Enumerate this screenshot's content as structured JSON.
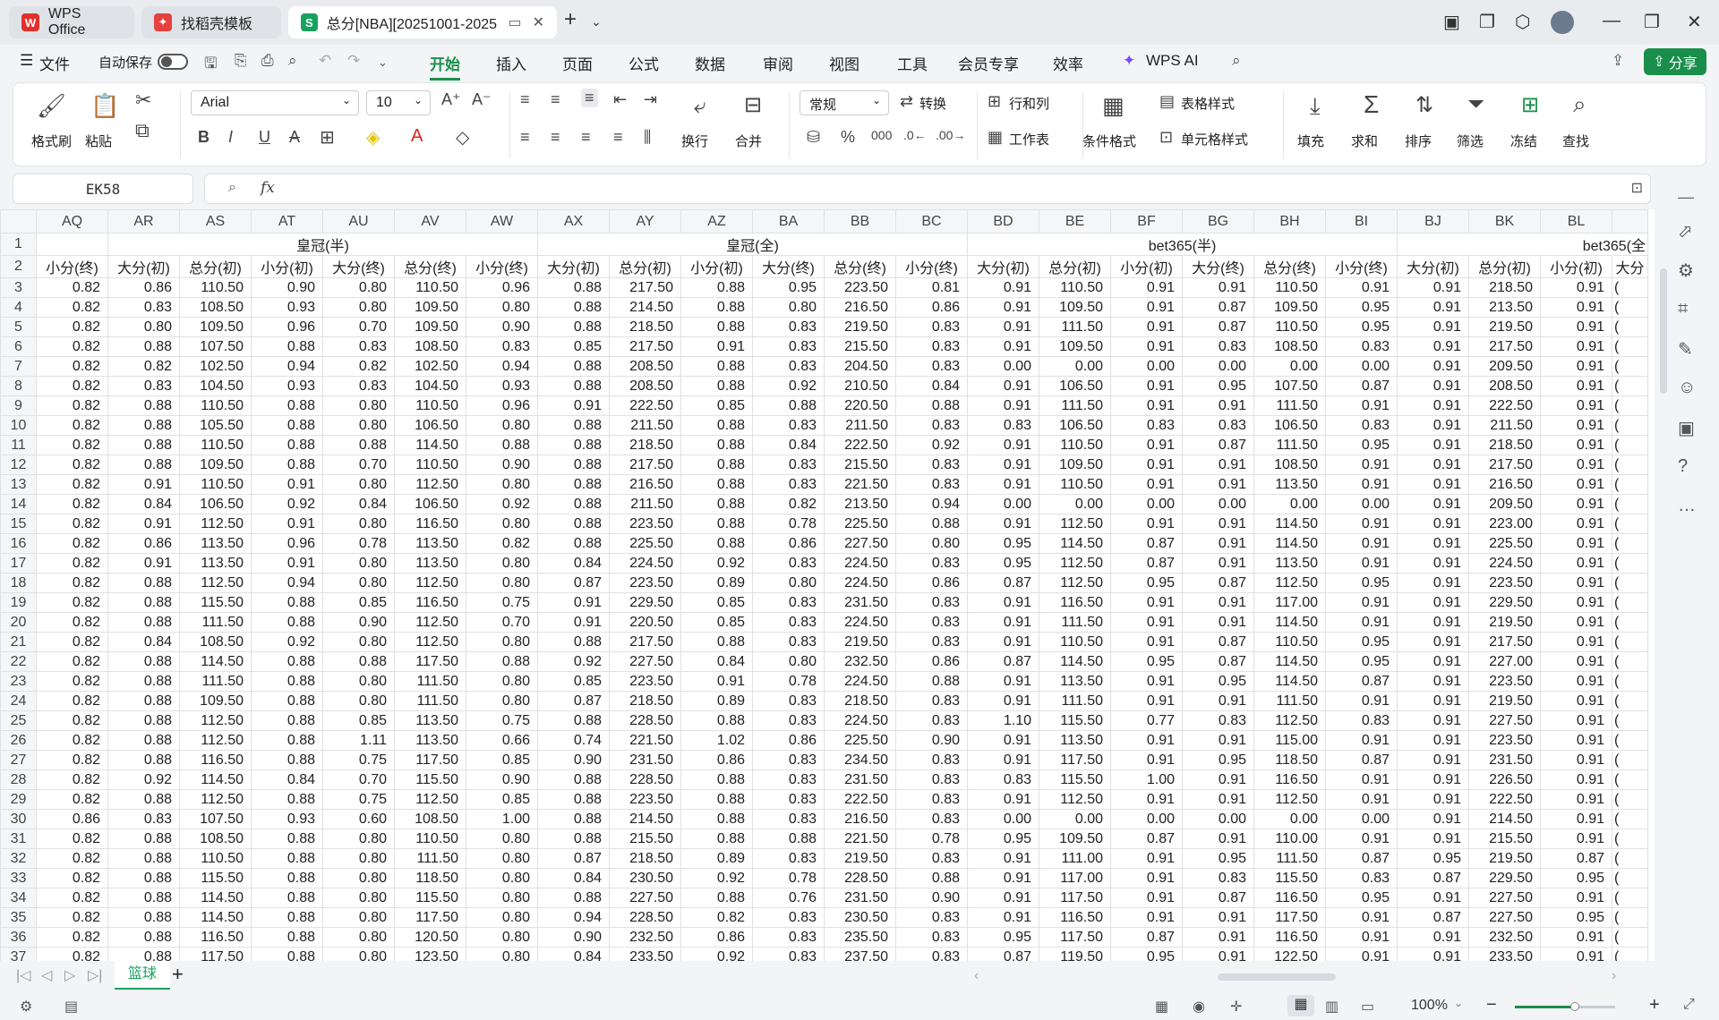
{
  "tabs": [
    {
      "label": "WPS Office",
      "icon": "wps-logo-icon"
    },
    {
      "label": "找稻壳模板",
      "icon": "docer-icon"
    },
    {
      "label": "总分[NBA][20251001-2025",
      "icon": "sheet-icon"
    }
  ],
  "menu": {
    "file": "文件",
    "autosave": "自动保存",
    "items": [
      "开始",
      "插入",
      "页面",
      "公式",
      "数据",
      "审阅",
      "视图",
      "工具",
      "会员专享",
      "效率"
    ],
    "wps_ai": "WPS AI",
    "share": "分享"
  },
  "ribbon": {
    "format_painter": "格式刷",
    "paste": "粘贴",
    "font": "Arial",
    "font_size": "10",
    "wrap": "换行",
    "merge": "合并",
    "number_format": "常规",
    "convert": "转换",
    "row_col": "行和列",
    "worksheet": "工作表",
    "cond_format": "条件格式",
    "table_style": "表格样式",
    "cell_style": "单元格样式",
    "fill": "填充",
    "sum": "求和",
    "sort": "排序",
    "filter": "筛选",
    "freeze": "冻结",
    "find": "查找"
  },
  "namebox": "EK58",
  "fx": "fx",
  "columns": [
    "AQ",
    "AR",
    "AS",
    "AT",
    "AU",
    "AV",
    "AW",
    "AX",
    "AY",
    "AZ",
    "BA",
    "BB",
    "BC",
    "BD",
    "BE",
    "BF",
    "BG",
    "BH",
    "BI",
    "BJ",
    "BK",
    "BL"
  ],
  "row1": {
    "huangguan_half": "皇冠(半)",
    "huangguan_full": "皇冠(全)",
    "bet365_half": "bet365(半)",
    "bet365_full": "bet365(全"
  },
  "row2": [
    "小分(终)",
    "大分(初)",
    "总分(初)",
    "小分(初)",
    "大分(终)",
    "总分(终)",
    "小分(终)",
    "大分(初)",
    "总分(初)",
    "小分(初)",
    "大分(终)",
    "总分(终)",
    "小分(终)",
    "大分(初)",
    "总分(初)",
    "小分(初)",
    "大分(终)",
    "总分(终)",
    "小分(终)",
    "大分(初)",
    "总分(初)",
    "小分(初)",
    "大分"
  ],
  "rows": [
    [
      "0.82",
      "0.86",
      "110.50",
      "0.90",
      "0.80",
      "110.50",
      "0.96",
      "0.88",
      "217.50",
      "0.88",
      "0.95",
      "223.50",
      "0.81",
      "0.91",
      "110.50",
      "0.91",
      "0.91",
      "110.50",
      "0.91",
      "0.91",
      "218.50",
      "0.91"
    ],
    [
      "0.82",
      "0.83",
      "108.50",
      "0.93",
      "0.80",
      "109.50",
      "0.80",
      "0.88",
      "214.50",
      "0.88",
      "0.80",
      "216.50",
      "0.86",
      "0.91",
      "109.50",
      "0.91",
      "0.87",
      "109.50",
      "0.95",
      "0.91",
      "213.50",
      "0.91"
    ],
    [
      "0.82",
      "0.80",
      "109.50",
      "0.96",
      "0.70",
      "109.50",
      "0.90",
      "0.88",
      "218.50",
      "0.88",
      "0.83",
      "219.50",
      "0.83",
      "0.91",
      "111.50",
      "0.91",
      "0.87",
      "110.50",
      "0.95",
      "0.91",
      "219.50",
      "0.91"
    ],
    [
      "0.82",
      "0.88",
      "107.50",
      "0.88",
      "0.83",
      "108.50",
      "0.83",
      "0.85",
      "217.50",
      "0.91",
      "0.83",
      "215.50",
      "0.83",
      "0.91",
      "109.50",
      "0.91",
      "0.83",
      "108.50",
      "0.83",
      "0.91",
      "217.50",
      "0.91"
    ],
    [
      "0.82",
      "0.82",
      "102.50",
      "0.94",
      "0.82",
      "102.50",
      "0.94",
      "0.88",
      "208.50",
      "0.88",
      "0.83",
      "204.50",
      "0.83",
      "0.00",
      "0.00",
      "0.00",
      "0.00",
      "0.00",
      "0.00",
      "0.91",
      "209.50",
      "0.91"
    ],
    [
      "0.82",
      "0.83",
      "104.50",
      "0.93",
      "0.83",
      "104.50",
      "0.93",
      "0.88",
      "208.50",
      "0.88",
      "0.92",
      "210.50",
      "0.84",
      "0.91",
      "106.50",
      "0.91",
      "0.95",
      "107.50",
      "0.87",
      "0.91",
      "208.50",
      "0.91"
    ],
    [
      "0.82",
      "0.88",
      "110.50",
      "0.88",
      "0.80",
      "110.50",
      "0.96",
      "0.91",
      "222.50",
      "0.85",
      "0.88",
      "220.50",
      "0.88",
      "0.91",
      "111.50",
      "0.91",
      "0.91",
      "111.50",
      "0.91",
      "0.91",
      "222.50",
      "0.91"
    ],
    [
      "0.82",
      "0.88",
      "105.50",
      "0.88",
      "0.80",
      "106.50",
      "0.80",
      "0.88",
      "211.50",
      "0.88",
      "0.83",
      "211.50",
      "0.83",
      "0.83",
      "106.50",
      "0.83",
      "0.83",
      "106.50",
      "0.83",
      "0.91",
      "211.50",
      "0.91"
    ],
    [
      "0.82",
      "0.88",
      "110.50",
      "0.88",
      "0.88",
      "114.50",
      "0.88",
      "0.88",
      "218.50",
      "0.88",
      "0.84",
      "222.50",
      "0.92",
      "0.91",
      "110.50",
      "0.91",
      "0.87",
      "111.50",
      "0.95",
      "0.91",
      "218.50",
      "0.91"
    ],
    [
      "0.82",
      "0.88",
      "109.50",
      "0.88",
      "0.70",
      "110.50",
      "0.90",
      "0.88",
      "217.50",
      "0.88",
      "0.83",
      "215.50",
      "0.83",
      "0.91",
      "109.50",
      "0.91",
      "0.91",
      "108.50",
      "0.91",
      "0.91",
      "217.50",
      "0.91"
    ],
    [
      "0.82",
      "0.91",
      "110.50",
      "0.91",
      "0.80",
      "112.50",
      "0.80",
      "0.88",
      "216.50",
      "0.88",
      "0.83",
      "221.50",
      "0.83",
      "0.91",
      "110.50",
      "0.91",
      "0.91",
      "113.50",
      "0.91",
      "0.91",
      "216.50",
      "0.91"
    ],
    [
      "0.82",
      "0.84",
      "106.50",
      "0.92",
      "0.84",
      "106.50",
      "0.92",
      "0.88",
      "211.50",
      "0.88",
      "0.82",
      "213.50",
      "0.94",
      "0.00",
      "0.00",
      "0.00",
      "0.00",
      "0.00",
      "0.00",
      "0.91",
      "209.50",
      "0.91"
    ],
    [
      "0.82",
      "0.91",
      "112.50",
      "0.91",
      "0.80",
      "116.50",
      "0.80",
      "0.88",
      "223.50",
      "0.88",
      "0.78",
      "225.50",
      "0.88",
      "0.91",
      "112.50",
      "0.91",
      "0.91",
      "114.50",
      "0.91",
      "0.91",
      "223.00",
      "0.91"
    ],
    [
      "0.82",
      "0.86",
      "113.50",
      "0.96",
      "0.78",
      "113.50",
      "0.82",
      "0.88",
      "225.50",
      "0.88",
      "0.86",
      "227.50",
      "0.80",
      "0.95",
      "114.50",
      "0.87",
      "0.91",
      "114.50",
      "0.91",
      "0.91",
      "225.50",
      "0.91"
    ],
    [
      "0.82",
      "0.91",
      "113.50",
      "0.91",
      "0.80",
      "113.50",
      "0.80",
      "0.84",
      "224.50",
      "0.92",
      "0.83",
      "224.50",
      "0.83",
      "0.95",
      "112.50",
      "0.87",
      "0.91",
      "113.50",
      "0.91",
      "0.91",
      "224.50",
      "0.91"
    ],
    [
      "0.82",
      "0.88",
      "112.50",
      "0.94",
      "0.80",
      "112.50",
      "0.80",
      "0.87",
      "223.50",
      "0.89",
      "0.80",
      "224.50",
      "0.86",
      "0.87",
      "112.50",
      "0.95",
      "0.87",
      "112.50",
      "0.95",
      "0.91",
      "223.50",
      "0.91"
    ],
    [
      "0.82",
      "0.88",
      "115.50",
      "0.88",
      "0.85",
      "116.50",
      "0.75",
      "0.91",
      "229.50",
      "0.85",
      "0.83",
      "231.50",
      "0.83",
      "0.91",
      "116.50",
      "0.91",
      "0.91",
      "117.00",
      "0.91",
      "0.91",
      "229.50",
      "0.91"
    ],
    [
      "0.82",
      "0.88",
      "111.50",
      "0.88",
      "0.90",
      "112.50",
      "0.70",
      "0.91",
      "220.50",
      "0.85",
      "0.83",
      "224.50",
      "0.83",
      "0.91",
      "111.50",
      "0.91",
      "0.91",
      "114.50",
      "0.91",
      "0.91",
      "219.50",
      "0.91"
    ],
    [
      "0.82",
      "0.84",
      "108.50",
      "0.92",
      "0.80",
      "112.50",
      "0.80",
      "0.88",
      "217.50",
      "0.88",
      "0.83",
      "219.50",
      "0.83",
      "0.91",
      "110.50",
      "0.91",
      "0.87",
      "110.50",
      "0.95",
      "0.91",
      "217.50",
      "0.91"
    ],
    [
      "0.82",
      "0.88",
      "114.50",
      "0.88",
      "0.88",
      "117.50",
      "0.88",
      "0.92",
      "227.50",
      "0.84",
      "0.80",
      "232.50",
      "0.86",
      "0.87",
      "114.50",
      "0.95",
      "0.87",
      "114.50",
      "0.95",
      "0.91",
      "227.00",
      "0.91"
    ],
    [
      "0.82",
      "0.88",
      "111.50",
      "0.88",
      "0.80",
      "111.50",
      "0.80",
      "0.85",
      "223.50",
      "0.91",
      "0.78",
      "224.50",
      "0.88",
      "0.91",
      "113.50",
      "0.91",
      "0.95",
      "114.50",
      "0.87",
      "0.91",
      "223.50",
      "0.91"
    ],
    [
      "0.82",
      "0.88",
      "109.50",
      "0.88",
      "0.80",
      "111.50",
      "0.80",
      "0.87",
      "218.50",
      "0.89",
      "0.83",
      "218.50",
      "0.83",
      "0.91",
      "111.50",
      "0.91",
      "0.91",
      "111.50",
      "0.91",
      "0.91",
      "219.50",
      "0.91"
    ],
    [
      "0.82",
      "0.88",
      "112.50",
      "0.88",
      "0.85",
      "113.50",
      "0.75",
      "0.88",
      "228.50",
      "0.88",
      "0.83",
      "224.50",
      "0.83",
      "1.10",
      "115.50",
      "0.77",
      "0.83",
      "112.50",
      "0.83",
      "0.91",
      "227.50",
      "0.91"
    ],
    [
      "0.82",
      "0.88",
      "112.50",
      "0.88",
      "1.11",
      "113.50",
      "0.66",
      "0.74",
      "221.50",
      "1.02",
      "0.86",
      "225.50",
      "0.90",
      "0.91",
      "113.50",
      "0.91",
      "0.91",
      "115.00",
      "0.91",
      "0.91",
      "223.50",
      "0.91"
    ],
    [
      "0.82",
      "0.88",
      "116.50",
      "0.88",
      "0.75",
      "117.50",
      "0.85",
      "0.90",
      "231.50",
      "0.86",
      "0.83",
      "234.50",
      "0.83",
      "0.91",
      "117.50",
      "0.91",
      "0.95",
      "118.50",
      "0.87",
      "0.91",
      "231.50",
      "0.91"
    ],
    [
      "0.82",
      "0.92",
      "114.50",
      "0.84",
      "0.70",
      "115.50",
      "0.90",
      "0.88",
      "228.50",
      "0.88",
      "0.83",
      "231.50",
      "0.83",
      "0.83",
      "115.50",
      "1.00",
      "0.91",
      "116.50",
      "0.91",
      "0.91",
      "226.50",
      "0.91"
    ],
    [
      "0.82",
      "0.88",
      "112.50",
      "0.88",
      "0.75",
      "112.50",
      "0.85",
      "0.88",
      "223.50",
      "0.88",
      "0.83",
      "222.50",
      "0.83",
      "0.91",
      "112.50",
      "0.91",
      "0.91",
      "112.50",
      "0.91",
      "0.91",
      "222.50",
      "0.91"
    ],
    [
      "0.86",
      "0.83",
      "107.50",
      "0.93",
      "0.60",
      "108.50",
      "1.00",
      "0.88",
      "214.50",
      "0.88",
      "0.83",
      "216.50",
      "0.83",
      "0.00",
      "0.00",
      "0.00",
      "0.00",
      "0.00",
      "0.00",
      "0.91",
      "214.50",
      "0.91"
    ],
    [
      "0.82",
      "0.88",
      "108.50",
      "0.88",
      "0.80",
      "110.50",
      "0.80",
      "0.88",
      "215.50",
      "0.88",
      "0.88",
      "221.50",
      "0.78",
      "0.95",
      "109.50",
      "0.87",
      "0.91",
      "110.00",
      "0.91",
      "0.91",
      "215.50",
      "0.91"
    ],
    [
      "0.82",
      "0.88",
      "110.50",
      "0.88",
      "0.80",
      "111.50",
      "0.80",
      "0.87",
      "218.50",
      "0.89",
      "0.83",
      "219.50",
      "0.83",
      "0.91",
      "111.00",
      "0.91",
      "0.95",
      "111.50",
      "0.87",
      "0.95",
      "219.50",
      "0.87"
    ],
    [
      "0.82",
      "0.88",
      "115.50",
      "0.88",
      "0.80",
      "118.50",
      "0.80",
      "0.84",
      "230.50",
      "0.92",
      "0.78",
      "228.50",
      "0.88",
      "0.91",
      "117.00",
      "0.91",
      "0.83",
      "115.50",
      "0.83",
      "0.87",
      "229.50",
      "0.95"
    ],
    [
      "0.82",
      "0.88",
      "114.50",
      "0.88",
      "0.80",
      "115.50",
      "0.80",
      "0.88",
      "227.50",
      "0.88",
      "0.76",
      "231.50",
      "0.90",
      "0.91",
      "117.50",
      "0.91",
      "0.87",
      "116.50",
      "0.95",
      "0.91",
      "227.50",
      "0.91"
    ],
    [
      "0.82",
      "0.88",
      "114.50",
      "0.88",
      "0.80",
      "117.50",
      "0.80",
      "0.94",
      "228.50",
      "0.82",
      "0.83",
      "230.50",
      "0.83",
      "0.91",
      "116.50",
      "0.91",
      "0.91",
      "117.50",
      "0.91",
      "0.87",
      "227.50",
      "0.95"
    ],
    [
      "0.82",
      "0.88",
      "116.50",
      "0.88",
      "0.80",
      "120.50",
      "0.80",
      "0.90",
      "232.50",
      "0.86",
      "0.83",
      "235.50",
      "0.83",
      "0.95",
      "117.50",
      "0.87",
      "0.91",
      "116.50",
      "0.91",
      "0.91",
      "232.50",
      "0.91"
    ],
    [
      "0.82",
      "0.88",
      "117.50",
      "0.88",
      "0.80",
      "123.50",
      "0.80",
      "0.84",
      "233.50",
      "0.92",
      "0.83",
      "237.50",
      "0.83",
      "0.87",
      "119.50",
      "0.95",
      "0.91",
      "122.50",
      "0.91",
      "0.91",
      "233.50",
      "0.91"
    ]
  ],
  "row_start": 3,
  "sheet_tab": "篮球",
  "zoom": "100%",
  "colors": {
    "accent": "#1a8f4b",
    "sheet_green": "#19a15f"
  }
}
